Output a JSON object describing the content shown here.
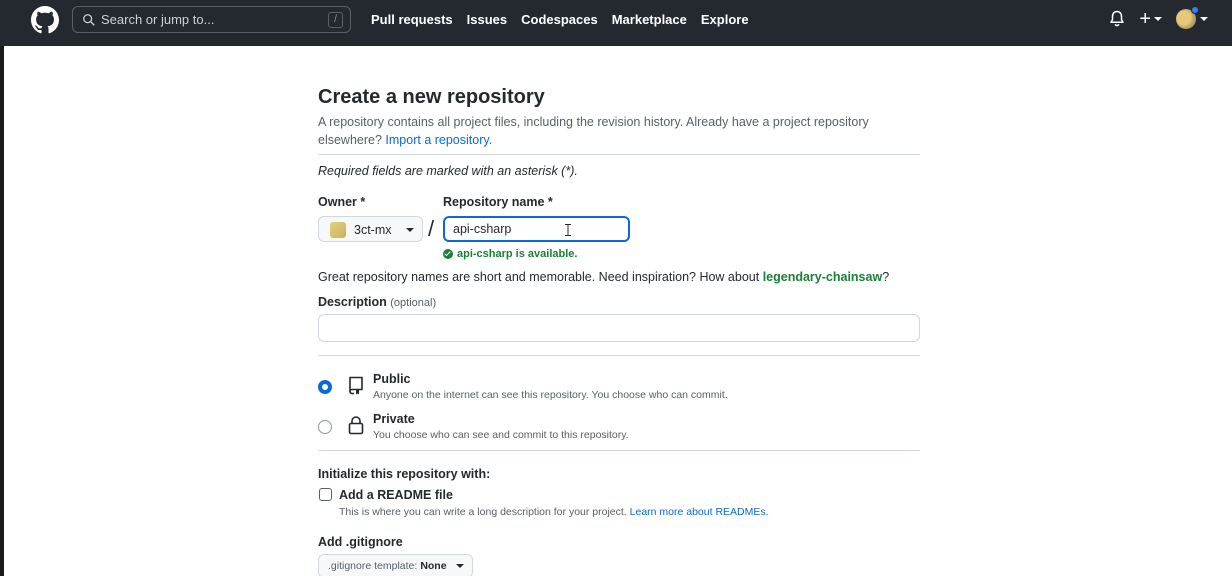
{
  "header": {
    "search_placeholder": "Search or jump to...",
    "search_shortcut": "/",
    "nav": [
      "Pull requests",
      "Issues",
      "Codespaces",
      "Marketplace",
      "Explore"
    ],
    "plus_label": "+"
  },
  "page": {
    "title": "Create a new repository",
    "lead_text": "A repository contains all project files, including the revision history. Already have a project repository elsewhere?",
    "import_link": "Import a repository.",
    "required_note": "Required fields are marked with an asterisk (*).",
    "owner_label": "Owner *",
    "owner_value": "3ct-mx",
    "separator": "/",
    "repo_name_label": "Repository name *",
    "repo_name_value": "api-csharp",
    "availability": "api-csharp is available.",
    "inspiration_text": "Great repository names are short and memorable. Need inspiration? How about",
    "suggestion": "legendary-chainsaw",
    "suggestion_suffix": "?",
    "description_label": "Description",
    "description_optional": "(optional)",
    "description_value": "",
    "visibility": [
      {
        "title": "Public",
        "desc": "Anyone on the internet can see this repository. You choose who can commit.",
        "selected": true
      },
      {
        "title": "Private",
        "desc": "You choose who can see and commit to this repository.",
        "selected": false
      }
    ],
    "init_label": "Initialize this repository with:",
    "readme_title": "Add a README file",
    "readme_desc": "This is where you can write a long description for your project.",
    "readme_link": "Learn more about READMEs.",
    "readme_checked": false,
    "gitignore_label": "Add .gitignore",
    "gitignore_prefix": ".gitignore template:",
    "gitignore_value": "None"
  },
  "colors": {
    "header_bg": "#24292f",
    "accent": "#0969da",
    "success": "#1a7f37"
  }
}
